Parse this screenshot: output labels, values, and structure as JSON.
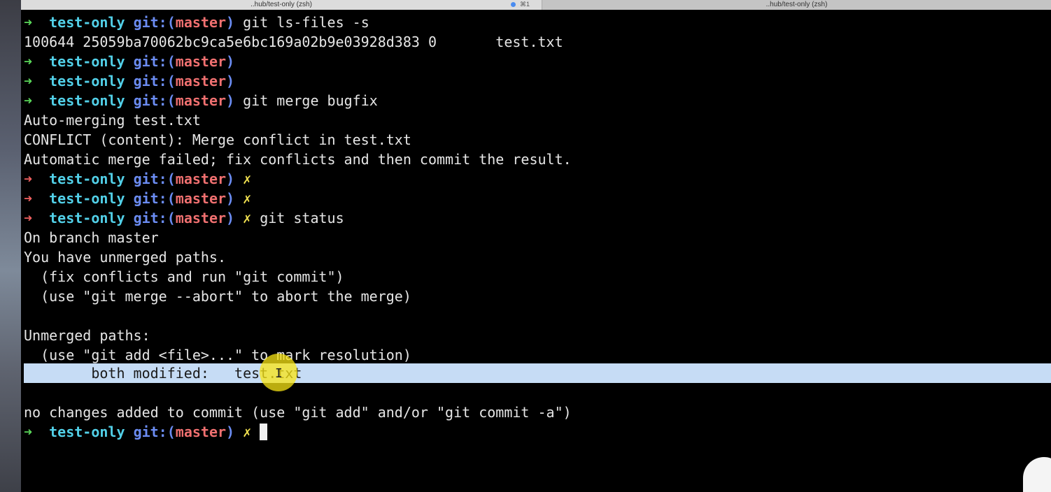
{
  "tabs": {
    "active_title": "..hub/test-only (zsh)",
    "active_shortcut": "⌘1",
    "inactive_title": "..hub/test-only (zsh)"
  },
  "prompt": {
    "arrow": "➜",
    "dir": "test-only",
    "git_label": "git:(",
    "branch": "master",
    "git_close": ")",
    "dirty_mark": "✗"
  },
  "commands": {
    "ls_files": "git ls-files -s",
    "merge": "git merge bugfix",
    "status": "git status"
  },
  "output": {
    "ls_files_result": "100644 25059ba70062bc9ca5e6bc169a02b9e03928d383 0       test.txt",
    "merge_1": "Auto-merging test.txt",
    "merge_2": "CONFLICT (content): Merge conflict in test.txt",
    "merge_3": "Automatic merge failed; fix conflicts and then commit the result.",
    "status_1": "On branch master",
    "status_2": "You have unmerged paths.",
    "status_3": "  (fix conflicts and run \"git commit\")",
    "status_4": "  (use \"git merge --abort\" to abort the merge)",
    "status_5": "Unmerged paths:",
    "status_6": "  (use \"git add <file>...\" to mark resolution)",
    "status_7": "        both modified:   test.txt",
    "status_8": "no changes added to commit (use \"git add\" and/or \"git commit -a\")"
  },
  "colors": {
    "background": "#000000",
    "arrow_ok": "#5ad85a",
    "arrow_err": "#f06060",
    "dir": "#52d0e8",
    "git": "#6b8cf2",
    "branch": "#f07070",
    "dirty": "#f0e050",
    "selection": "#c6dcf5"
  },
  "icons": {
    "mouse_cursor": "ibeam-cursor-icon"
  }
}
